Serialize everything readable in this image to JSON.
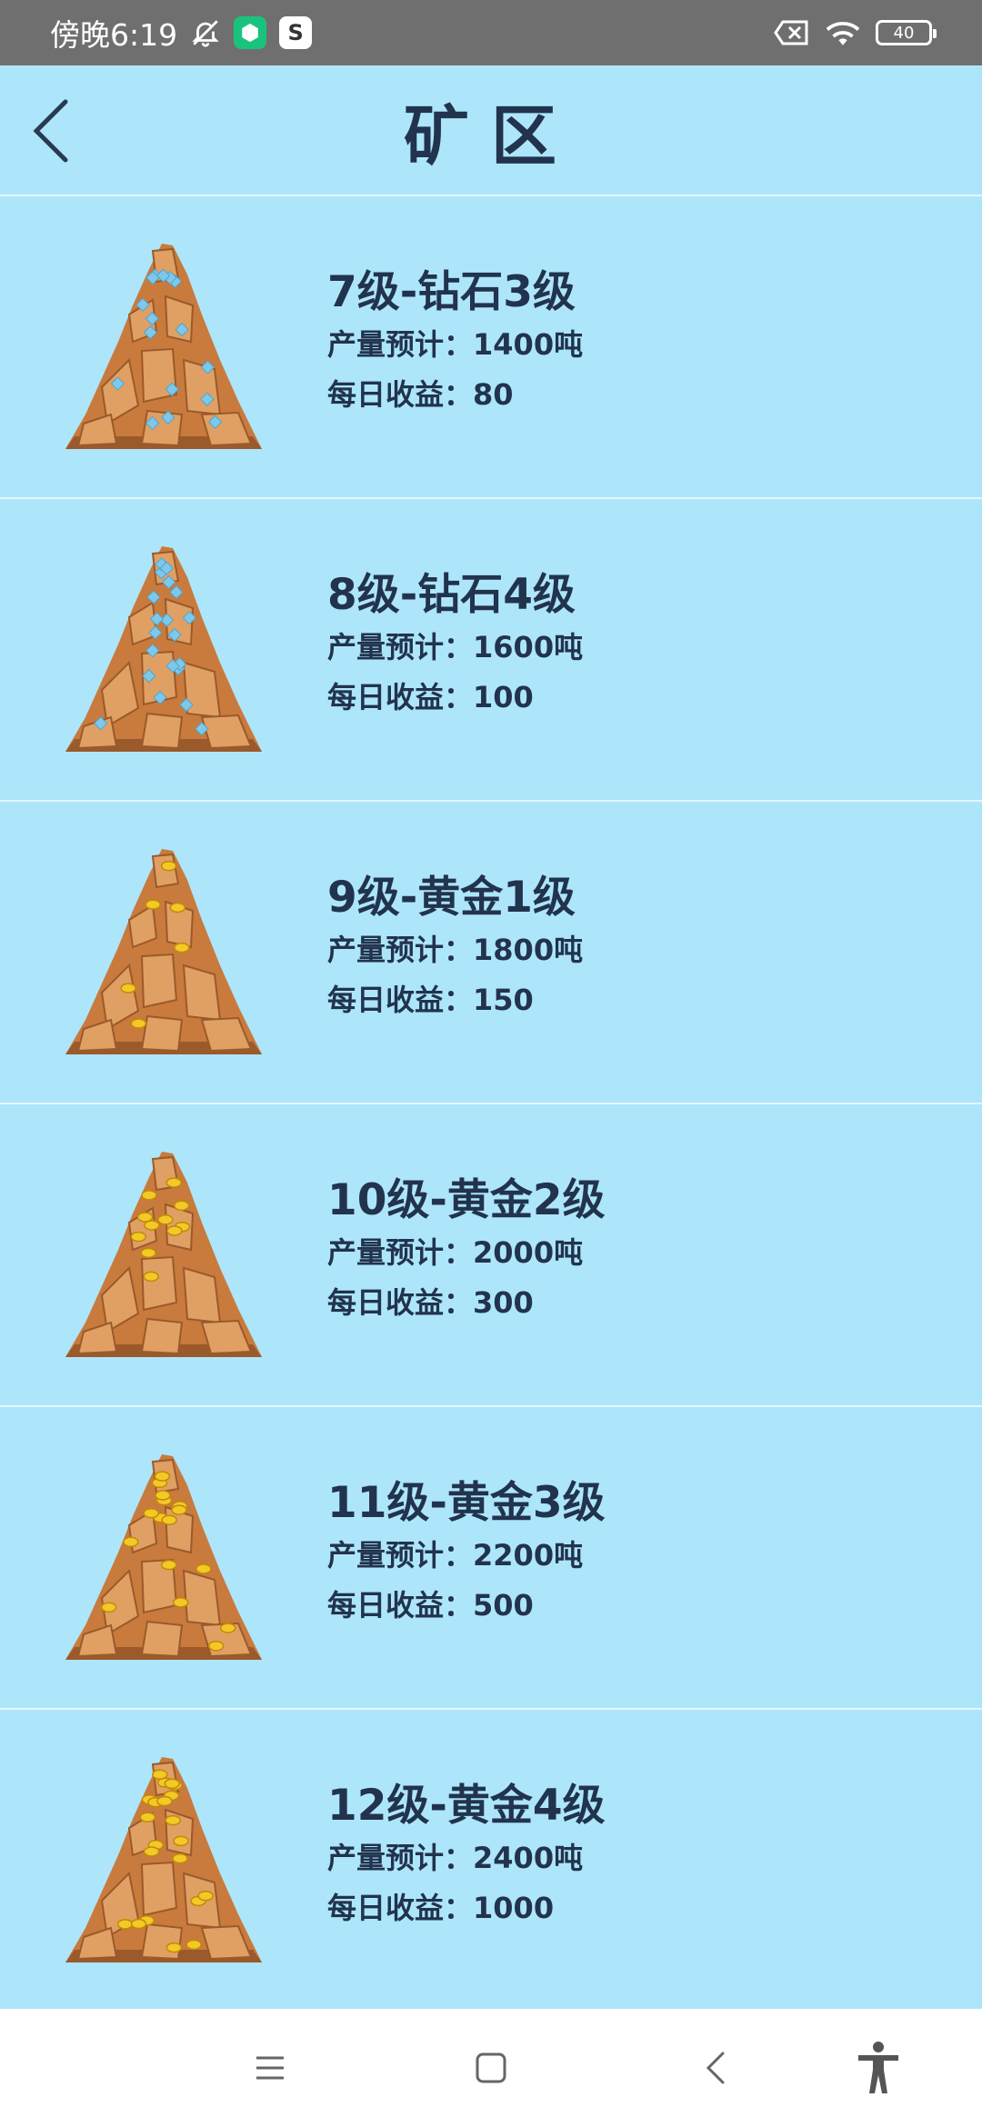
{
  "status_bar": {
    "time": "傍晚6:19",
    "app_badge_1": "⬢",
    "app_badge_2": "S",
    "battery": "40"
  },
  "header": {
    "title": "矿区"
  },
  "mines": [
    {
      "title": "7级-钻石3级",
      "production_label": "产量预计：",
      "production": "1400吨",
      "income_label": "每日收益：",
      "income": "80",
      "gem": "diamond",
      "gem_color": "#7EC8EA"
    },
    {
      "title": "8级-钻石4级",
      "production_label": "产量预计：",
      "production": "1600吨",
      "income_label": "每日收益：",
      "income": "100",
      "gem": "diamond",
      "gem_color": "#7EC8EA"
    },
    {
      "title": "9级-黄金1级",
      "production_label": "产量预计：",
      "production": "1800吨",
      "income_label": "每日收益：",
      "income": "150",
      "gem": "gold",
      "gem_color": "#F3C928"
    },
    {
      "title": "10级-黄金2级",
      "production_label": "产量预计：",
      "production": "2000吨",
      "income_label": "每日收益：",
      "income": "300",
      "gem": "gold",
      "gem_color": "#F3C928"
    },
    {
      "title": "11级-黄金3级",
      "production_label": "产量预计：",
      "production": "2200吨",
      "income_label": "每日收益：",
      "income": "500",
      "gem": "gold",
      "gem_color": "#F3C928"
    },
    {
      "title": "12级-黄金4级",
      "production_label": "产量预计：",
      "production": "2400吨",
      "income_label": "每日收益：",
      "income": "1000",
      "gem": "gold",
      "gem_color": "#F3C928"
    }
  ],
  "colors": {
    "background": "#ADE6FB",
    "text": "#22334D",
    "mountain": "#C97A3D",
    "mountain_dark": "#9A5A2B",
    "mountain_light": "#E0A063"
  },
  "nav": {
    "menu_icon": "menu-icon",
    "home_icon": "home-icon",
    "back_icon": "back-icon",
    "accessibility_icon": "accessibility-icon"
  }
}
